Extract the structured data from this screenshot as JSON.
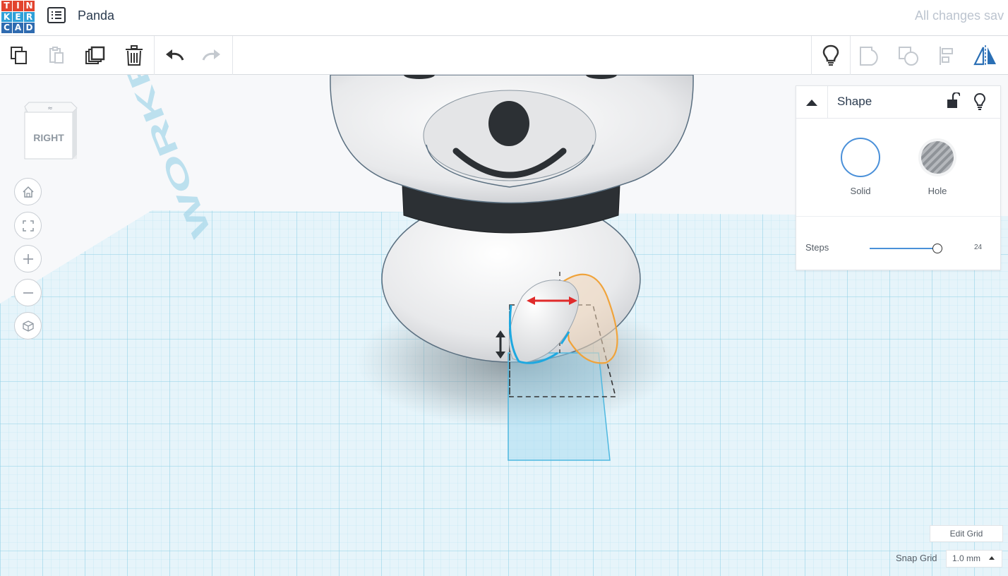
{
  "app": {
    "logo_letters": [
      "T",
      "I",
      "N",
      "K",
      "E",
      "R",
      "C",
      "A",
      "D"
    ],
    "logo_colors": [
      "#e2442f",
      "#e2442f",
      "#e2442f",
      "#2fa0d8",
      "#2fa0d8",
      "#2fa0d8",
      "#2f6bb0",
      "#2f6bb0",
      "#2f6bb0"
    ],
    "document_title": "Panda",
    "save_status": "All changes sav"
  },
  "toolbar": {
    "items": [
      {
        "name": "copy-button",
        "icon": "copy-icon",
        "enabled": true
      },
      {
        "name": "paste-button",
        "icon": "paste-icon",
        "enabled": false
      },
      {
        "name": "duplicate-button",
        "icon": "duplicate-icon",
        "enabled": true
      },
      {
        "name": "delete-button",
        "icon": "trash-icon",
        "enabled": true
      },
      {
        "name": "undo-button",
        "icon": "undo-icon",
        "enabled": true
      },
      {
        "name": "redo-button",
        "icon": "redo-icon",
        "enabled": false
      }
    ],
    "right_items": [
      {
        "name": "notes-button",
        "icon": "lightbulb-icon",
        "enabled": true
      },
      {
        "name": "group-button",
        "icon": "group-icon",
        "enabled": false
      },
      {
        "name": "ungroup-button",
        "icon": "ungroup-icon",
        "enabled": false
      },
      {
        "name": "align-button",
        "icon": "align-icon",
        "enabled": false
      },
      {
        "name": "mirror-button",
        "icon": "mirror-icon",
        "enabled": true
      }
    ]
  },
  "viewcube": {
    "face_label": "RIGHT"
  },
  "workplane": {
    "watermark": "WORKPLANE"
  },
  "nav_controls": [
    "home-icon",
    "fit-icon",
    "zoom-in-icon",
    "zoom-out-icon",
    "perspective-icon"
  ],
  "shape_panel": {
    "title": "Shape",
    "solid_label": "Solid",
    "hole_label": "Hole",
    "steps_label": "Steps",
    "steps_value": "24",
    "steps_fraction": 0.96,
    "accent_color": "#4a90d9"
  },
  "grid_controls": {
    "edit_grid_label": "Edit Grid",
    "snap_grid_label": "Snap Grid",
    "snap_grid_value": "1.0 mm"
  }
}
